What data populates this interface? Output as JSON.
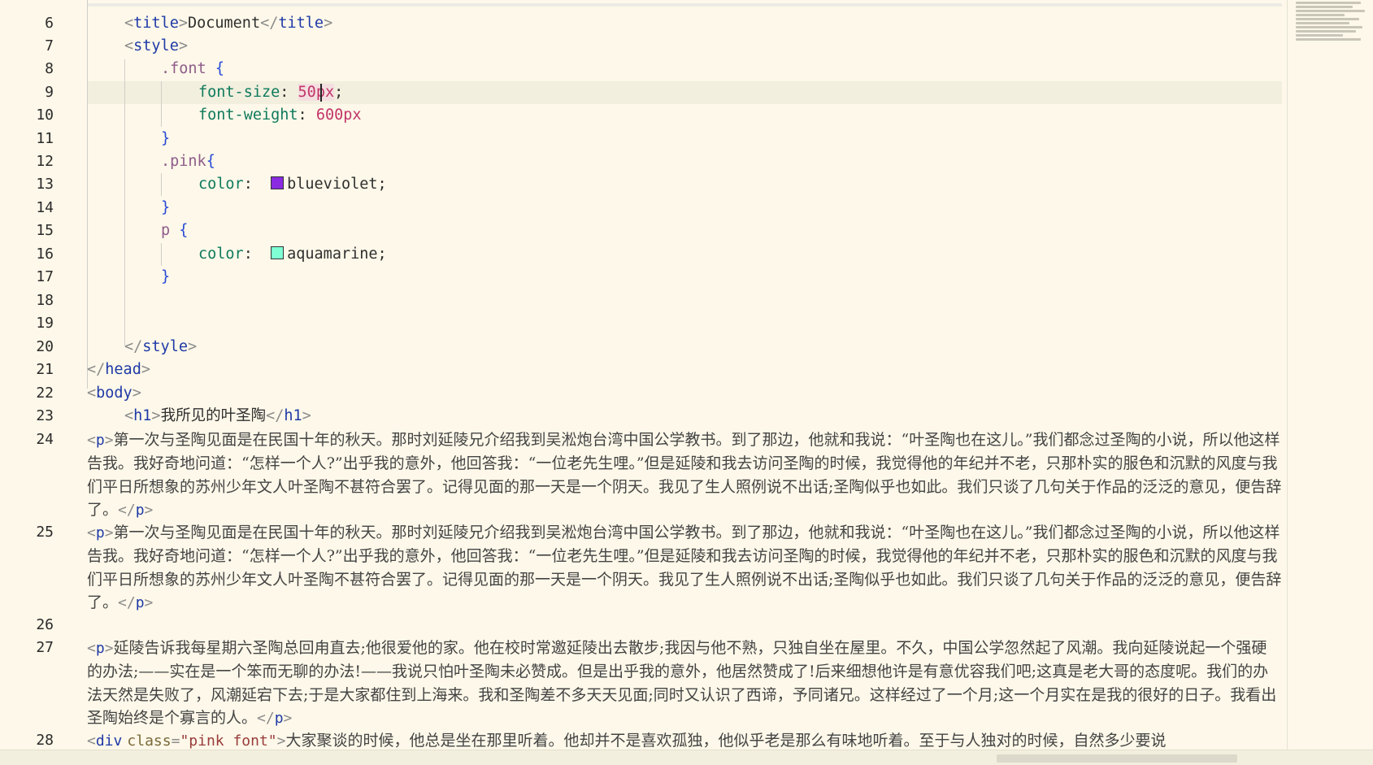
{
  "editor": {
    "line_numbers": [
      "6",
      "7",
      "8",
      "9",
      "10",
      "11",
      "12",
      "13",
      "14",
      "15",
      "16",
      "17",
      "18",
      "19",
      "20",
      "21",
      "22",
      "23",
      "24",
      "25",
      "26",
      "27",
      "28"
    ],
    "code": {
      "l6": {
        "open": "<",
        "tag": "title",
        "close": ">",
        "text": "Document",
        "endopen": "</",
        "endtag": "title",
        "endclose": ">"
      },
      "l7": {
        "open": "<",
        "tag": "style",
        "close": ">"
      },
      "l8": {
        "selector": ".font",
        "brace": "{"
      },
      "l9": {
        "prop": "font-size",
        "colon": ":",
        "num": "50",
        "unit": "px",
        "semi": ";"
      },
      "l10": {
        "prop": "font-weight",
        "colon": ":",
        "num": "600",
        "unit": "px"
      },
      "l11": {
        "brace": "}"
      },
      "l12": {
        "selector": ".pink",
        "brace": "{"
      },
      "l13": {
        "prop": "color",
        "colon": ":",
        "value": "blueviolet",
        "semi": ";",
        "swatch": "#8a2be2"
      },
      "l14": {
        "brace": "}"
      },
      "l15": {
        "selector": "p",
        "brace": "{"
      },
      "l16": {
        "prop": "color",
        "colon": ":",
        "value": "aquamarine",
        "semi": ";",
        "swatch": "#7fffd4"
      },
      "l17": {
        "brace": "}"
      },
      "l20": {
        "open": "</",
        "tag": "style",
        "close": ">"
      },
      "l21": {
        "open": "</",
        "tag": "head",
        "close": ">"
      },
      "l22": {
        "open": "<",
        "tag": "body",
        "close": ">"
      },
      "l23": {
        "open": "<",
        "tag": "h1",
        "close": ">",
        "text": "我所见的叶圣陶",
        "endopen": "</",
        "endtag": "h1",
        "endclose": ">"
      },
      "l24": {
        "open": "<",
        "tag": "p",
        "close": ">",
        "text": "第一次与圣陶见面是在民国十年的秋天。那时刘延陵兄介绍我到吴淞炮台湾中国公学教书。到了那边，他就和我说：“叶圣陶也在这儿。”我们都念过圣陶的小说，所以他这样告我。我好奇地问道：“怎样一个人?”出乎我的意外，他回答我：“一位老先生哩。”但是延陵和我去访问圣陶的时候，我觉得他的年纪并不老，只那朴实的服色和沉默的风度与我们平日所想象的苏州少年文人叶圣陶不甚符合罢了。记得见面的那一天是一个阴天。我见了生人照例说不出话;圣陶似乎也如此。我们只谈了几句关于作品的泛泛的意见，便告辞了。",
        "endopen": "</",
        "endtag": "p",
        "endclose": ">"
      },
      "l25": {
        "open": "<",
        "tag": "p",
        "close": ">",
        "text": "第一次与圣陶见面是在民国十年的秋天。那时刘延陵兄介绍我到吴淞炮台湾中国公学教书。到了那边，他就和我说：“叶圣陶也在这儿。”我们都念过圣陶的小说，所以他这样告我。我好奇地问道：“怎样一个人?”出乎我的意外，他回答我：“一位老先生哩。”但是延陵和我去访问圣陶的时候，我觉得他的年纪并不老，只那朴实的服色和沉默的风度与我们平日所想象的苏州少年文人叶圣陶不甚符合罢了。记得见面的那一天是一个阴天。我见了生人照例说不出话;圣陶似乎也如此。我们只谈了几句关于作品的泛泛的意见，便告辞了。",
        "endopen": "</",
        "endtag": "p",
        "endclose": ">"
      },
      "l27": {
        "open": "<",
        "tag": "p",
        "close": ">",
        "text": "延陵告诉我每星期六圣陶总回甪直去;他很爱他的家。他在校时常邀延陵出去散步;我因与他不熟，只独自坐在屋里。不久，中国公学忽然起了风潮。我向延陵说起一个强硬的办法;——实在是一个笨而无聊的办法!——我说只怕叶圣陶未必赞成。但是出乎我的意外，他居然赞成了!后来细想他许是有意优容我们吧;这真是老大哥的态度呢。我们的办法天然是失败了，风潮延宕下去;于是大家都住到上海来。我和圣陶差不多天天见面;同时又认识了西谛，予同诸兄。这样经过了一个月;这一个月实在是我的很好的日子。我看出圣陶始终是个寡言的人。",
        "endopen": "</",
        "endtag": "p",
        "endclose": ">"
      },
      "l28": {
        "open": "<",
        "tag": "div",
        "attr": "class",
        "eq": "=",
        "val": "\"pink font\"",
        "close": ">",
        "text": "大家聚谈的时候，他总是坐在那里听着。他却并不是喜欢孤独，他似乎老是那么有味地听着。至于与人独对的时候，自然多少要说"
      }
    }
  }
}
